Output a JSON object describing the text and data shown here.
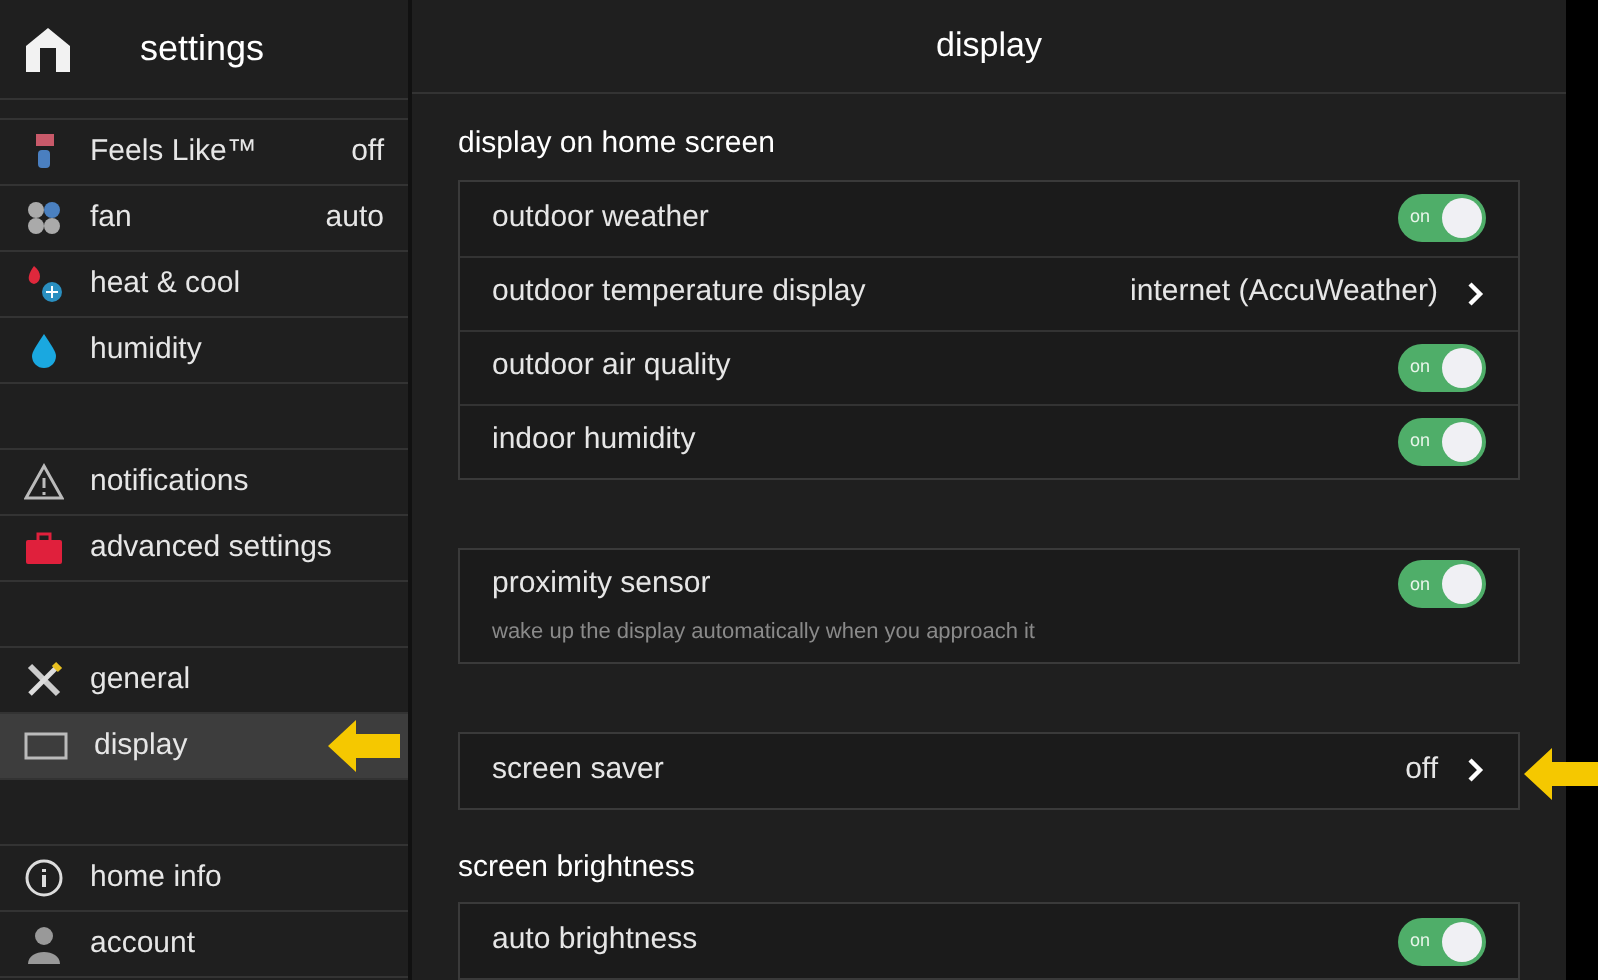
{
  "sidebar": {
    "title": "settings",
    "groups": [
      [
        {
          "kind": "feels_like",
          "label": "Feels Like™",
          "value": "off",
          "selected": false
        },
        {
          "kind": "fan",
          "label": "fan",
          "value": "auto",
          "selected": false
        },
        {
          "kind": "heat_cool",
          "label": "heat & cool",
          "selected": false
        },
        {
          "kind": "humidity",
          "label": "humidity",
          "selected": false
        }
      ],
      [
        {
          "kind": "notifications",
          "label": "notifications",
          "selected": false
        },
        {
          "kind": "advanced",
          "label": "advanced settings",
          "selected": false
        }
      ],
      [
        {
          "kind": "general",
          "label": "general",
          "selected": false
        },
        {
          "kind": "display",
          "label": "display",
          "selected": true
        }
      ],
      [
        {
          "kind": "home_info",
          "label": "home info",
          "selected": false
        },
        {
          "kind": "account",
          "label": "account",
          "selected": false
        }
      ]
    ]
  },
  "main": {
    "title": "display",
    "groups": [
      {
        "heading": "display on home screen",
        "rows": [
          {
            "kind": "toggle",
            "label": "outdoor weather",
            "on": true,
            "toggle_text": "on"
          },
          {
            "kind": "link",
            "label": "outdoor temperature display",
            "value": "internet (AccuWeather)"
          },
          {
            "kind": "toggle",
            "label": "outdoor air quality",
            "on": true,
            "toggle_text": "on"
          },
          {
            "kind": "toggle",
            "label": "indoor humidity",
            "on": true,
            "toggle_text": "on"
          }
        ]
      },
      {
        "rows": [
          {
            "kind": "toggle",
            "label": "proximity sensor",
            "on": true,
            "toggle_text": "on",
            "description": "wake up the display automatically when you approach it"
          }
        ]
      },
      {
        "rows": [
          {
            "kind": "link",
            "label": "screen saver",
            "value": "off"
          }
        ]
      },
      {
        "heading": "screen brightness",
        "rows": [
          {
            "kind": "toggle",
            "label": "auto brightness",
            "on": true,
            "toggle_text": "on"
          }
        ]
      }
    ]
  }
}
